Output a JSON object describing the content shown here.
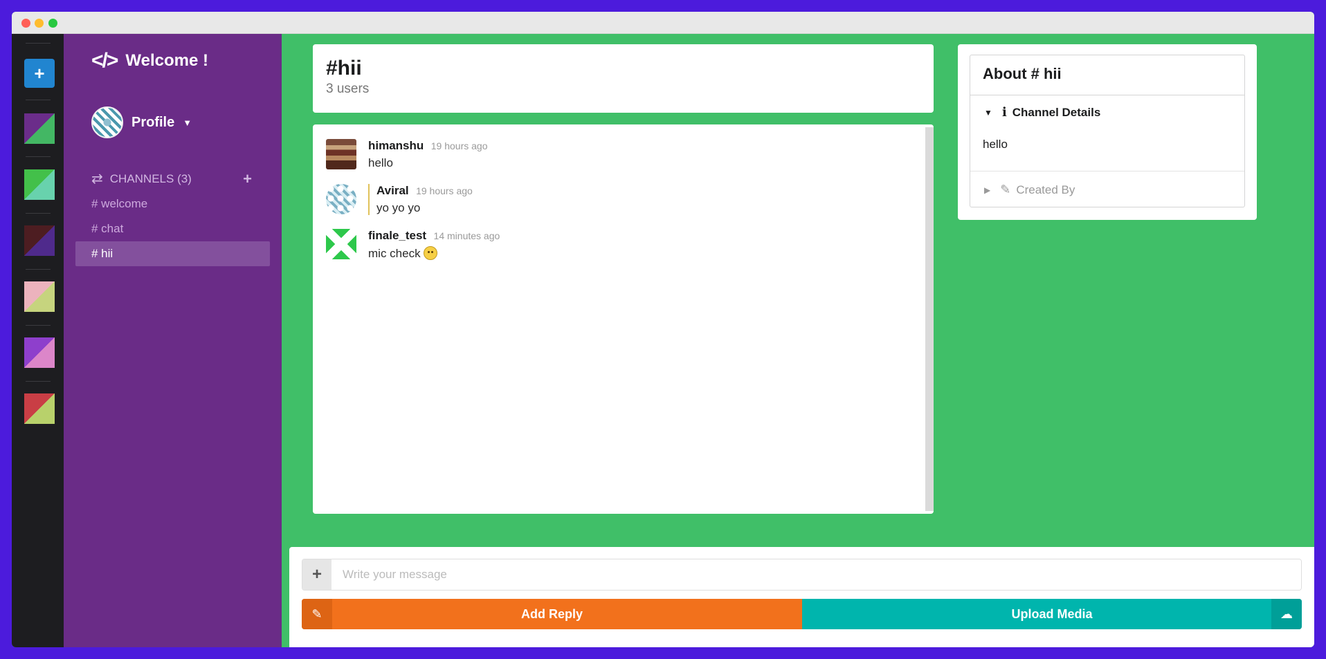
{
  "brand": {
    "title": "Welcome !"
  },
  "profile": {
    "label": "Profile"
  },
  "channels": {
    "heading": "CHANNELS (3)",
    "items": [
      {
        "label": "# welcome"
      },
      {
        "label": "# chat"
      },
      {
        "label": "# hii"
      }
    ]
  },
  "rail": {
    "add_label": "+",
    "swatches": [
      {
        "c1": "#43b764",
        "c2": "#6b2d8a"
      },
      {
        "c1": "#68d2ad",
        "c2": "#43c04a"
      },
      {
        "c1": "#4f2a8c",
        "c2": "#4d1d21"
      },
      {
        "c1": "#c6d47e",
        "c2": "#ecb3bd"
      },
      {
        "c1": "#dc86c9",
        "c2": "#8e3fcc"
      },
      {
        "c1": "#b8d16b",
        "c2": "#c93e45"
      }
    ]
  },
  "header": {
    "channel": "#hii",
    "users": "3 users"
  },
  "messages": [
    {
      "author": "himanshu",
      "time": "19 hours ago",
      "text": "hello"
    },
    {
      "author": "Aviral",
      "time": "19 hours ago",
      "text": "yo yo yo"
    },
    {
      "author": "finale_test",
      "time": "14 minutes ago",
      "text": "mic check"
    }
  ],
  "about": {
    "title": "About # hii",
    "details_label": "Channel Details",
    "details_text": "hello",
    "created_label": "Created By"
  },
  "composer": {
    "placeholder": "Write your message",
    "reply_label": "Add Reply",
    "upload_label": "Upload Media"
  },
  "colors": {
    "accent_green": "#40bf68",
    "sidebar_purple": "#6a2c87",
    "reply_orange": "#f2711c",
    "upload_teal": "#00b5ad"
  }
}
